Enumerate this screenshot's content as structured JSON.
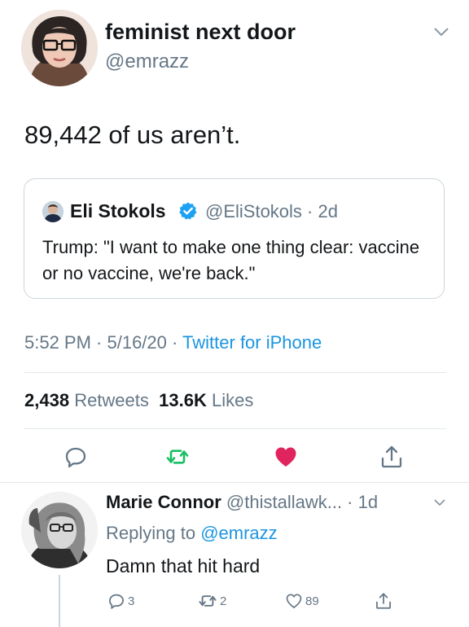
{
  "tweet": {
    "display_name": "feminist next door",
    "handle": "@emrazz",
    "text": "89,442 of us aren’t.",
    "quote": {
      "name": "Eli Stokols",
      "handle_time": "@EliStokols · 2d",
      "text": "Trump: \"I want to make one thing clear: vaccine or no vaccine, we're back.\""
    },
    "time": "5:52 PM · 5/16/20 · ",
    "source": "Twitter for iPhone",
    "retweets_count": "2,438",
    "retweets_label": "Retweets",
    "likes_count": "13.6K",
    "likes_label": "Likes"
  },
  "reply": {
    "name": "Marie Connor",
    "handle_time": "@thistallawk... · 1d",
    "replying_prefix": "Replying to ",
    "replying_to": "@emrazz",
    "text": "Damn that hit hard",
    "reply_count": "3",
    "retweet_count": "2",
    "like_count": "89"
  },
  "icons": {
    "chevron": "chevron-down-icon",
    "verified": "verified-badge-icon",
    "reply": "reply-icon",
    "retweet": "retweet-icon",
    "like": "heart-icon",
    "share": "share-icon"
  },
  "colors": {
    "link_blue": "#1b95e0",
    "retweet_green": "#17bf63",
    "like_red": "#e0245e",
    "secondary_text": "#657786"
  }
}
